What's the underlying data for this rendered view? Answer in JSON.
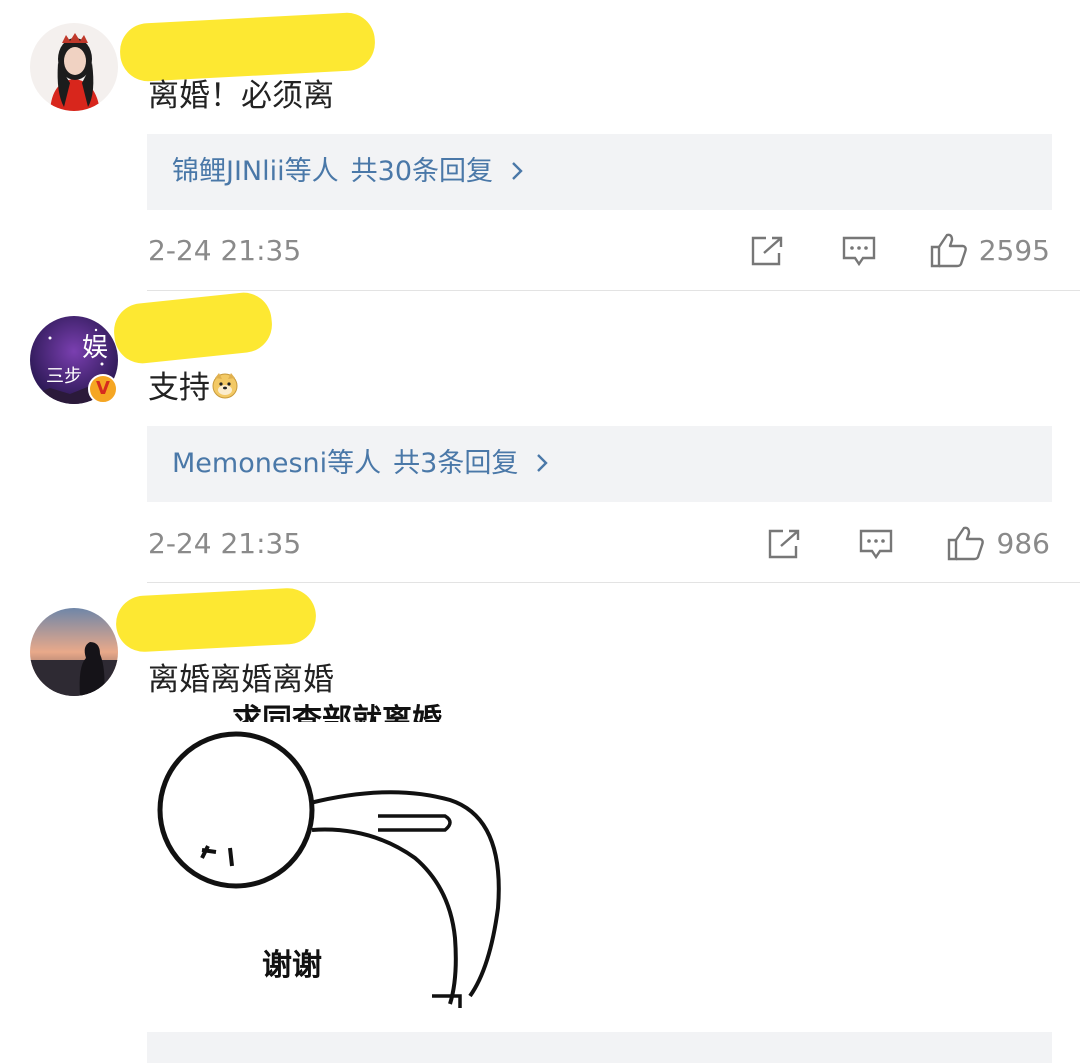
{
  "comments": [
    {
      "text": "离婚！必须离",
      "reply_names": "锦鲤JINlii等人",
      "reply_count": "共30条回复",
      "time": "2-24 21:35",
      "likes": "2595",
      "verified": false
    },
    {
      "text": "支持",
      "emoji": "doge-emoji",
      "reply_names": "Memonesni等人",
      "reply_count": "共3条回复",
      "time": "2-24 21:35",
      "likes": "986",
      "verified": true,
      "avatar_text_main": "娱",
      "avatar_text_sub": "三步"
    },
    {
      "text": "离婚离婚离婚",
      "image": {
        "top_caption": "求同查部就离婚",
        "caption": "谢谢"
      }
    }
  ],
  "icons": {
    "repost": "repost-icon",
    "comment": "comment-icon",
    "like": "thumbs-up-icon",
    "chevron": "chevron-right-icon"
  },
  "colors": {
    "reply_link": "#4a78a8",
    "name_redaction": "#fde832",
    "meta_text": "#8a8a8a",
    "reply_bg": "#f2f3f5"
  }
}
